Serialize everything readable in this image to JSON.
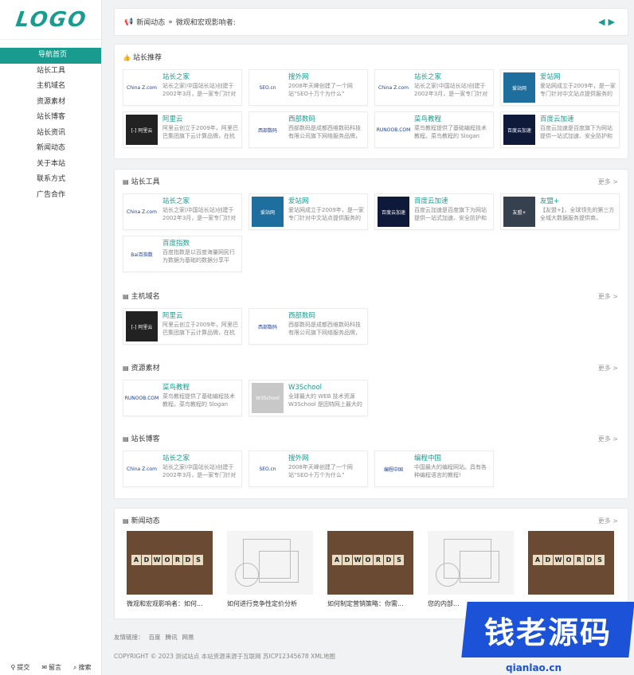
{
  "logo": "LOGO",
  "nav": [
    "导航首页",
    "站长工具",
    "主机域名",
    "资源素材",
    "站长博客",
    "站长资讯",
    "新闻动态",
    "关于本站",
    "联系方式",
    "广告合作"
  ],
  "side_footer": [
    {
      "icon": "location-icon",
      "label": "提交"
    },
    {
      "icon": "chat-icon",
      "label": "留言"
    },
    {
      "icon": "search-icon",
      "label": "搜索"
    }
  ],
  "newsbar": {
    "prefix": "新闻动态",
    "sep": "»",
    "text": "微观和宏观影响者:"
  },
  "recommend": {
    "title": "站长推荐",
    "sites": [
      {
        "name": "站长之家",
        "desc": "站长之家(中国站长站)创建于2002年3月，是一家专门针对",
        "thumb": "China Z.com",
        "style": "white"
      },
      {
        "name": "搜外网",
        "desc": "2008年天峰创建了一个网站“SEO十万个为什么”",
        "thumb": "SEO.cn",
        "style": "white"
      },
      {
        "name": "站长之家",
        "desc": "站长之家(中国站长站)创建于2002年3月，是一家专门针对",
        "thumb": "China Z.com",
        "style": "white"
      },
      {
        "name": "爱站网",
        "desc": "爱站网成立于2009年，是一家专门针对中文站点提供服务的",
        "thumb": "爱站网",
        "style": "blue"
      },
      {
        "name": "阿里云",
        "desc": "阿里云创立于2009年，阿里巴巴集团旗下云计算品牌，在杭",
        "thumb": "[-] 阿里云",
        "style": "dark"
      },
      {
        "name": "西部数码",
        "desc": "西部数码是成都西维数码科技有限公司旗下网络服务品牌，",
        "thumb": "西部数码",
        "style": "white"
      },
      {
        "name": "菜鸟教程",
        "desc": "菜鸟教程提供了基础编程技术教程。菜鸟教程的 Slogan",
        "thumb": "RUNOOB.COM",
        "style": "white"
      },
      {
        "name": "百度云加速",
        "desc": "百度云加速是百度旗下为网站提供一站式加速、安全防护和",
        "thumb": "百度云加速",
        "style": "navy"
      }
    ]
  },
  "tools": {
    "title": "站长工具",
    "more": "更多 >",
    "sites": [
      {
        "name": "站长之家",
        "desc": "站长之家(中国站长站)创建于2002年3月，是一家专门针对",
        "thumb": "China Z.com",
        "style": "white"
      },
      {
        "name": "爱站网",
        "desc": "爱站网成立于2009年，是一家专门针对中文站点提供服务的",
        "thumb": "爱站网",
        "style": "blue"
      },
      {
        "name": "百度云加速",
        "desc": "百度云加速是百度旗下为网站提供一站式加速、安全防护和",
        "thumb": "百度云加速",
        "style": "navy"
      },
      {
        "name": "友盟+",
        "desc": "【友盟+】，全球领先的第三方全域大数据服务提供商，",
        "thumb": "友盟+",
        "style": "slate"
      },
      {
        "name": "百度指数",
        "desc": "百度指数是以百度海量网民行为数据为基础的数据分享平",
        "thumb": "Bai百指数",
        "style": "white"
      }
    ]
  },
  "hosting": {
    "title": "主机域名",
    "more": "更多 >",
    "sites": [
      {
        "name": "阿里云",
        "desc": "阿里云创立于2009年，阿里巴巴集团旗下云计算品牌，在杭",
        "thumb": "[-] 阿里云",
        "style": "dark"
      },
      {
        "name": "西部数码",
        "desc": "西部数码是成都西维数码科技有限公司旗下网络服务品牌，",
        "thumb": "西部数码",
        "style": "white"
      }
    ]
  },
  "resources": {
    "title": "资源素材",
    "more": "更多 >",
    "sites": [
      {
        "name": "菜鸟教程",
        "desc": "菜鸟教程提供了基础编程技术教程。菜鸟教程的 Slogan",
        "thumb": "RUNOOB.COM",
        "style": "white"
      },
      {
        "name": "W3School",
        "desc": "全球最大的 WEB 技术资源 W3School 是因特网上最大的",
        "thumb": "W3School",
        "style": "gray"
      }
    ]
  },
  "blog": {
    "title": "站长博客",
    "more": "更多 >",
    "sites": [
      {
        "name": "站长之家",
        "desc": "站长之家(中国站长站)创建于2002年3月，是一家专门针对",
        "thumb": "China Z.com",
        "style": "white"
      },
      {
        "name": "搜外网",
        "desc": "2008年天峰创建了一个网站“SEO十万个为什么”",
        "thumb": "SEO.cn",
        "style": "white"
      },
      {
        "name": "编程中国",
        "desc": "中国最大的编程网站。具有各种编程语言的教程!",
        "thumb": "编程中国",
        "style": "white"
      }
    ]
  },
  "news": {
    "title": "新闻动态",
    "more": "更多 >",
    "items": [
      {
        "title": "微观和宏观影响者：如何...",
        "img": "adwords"
      },
      {
        "title": "如何进行竞争性定价分析",
        "img": "sketch"
      },
      {
        "title": "如何制定营销策略：你需...",
        "img": "adwords"
      },
      {
        "title": "您的内部...",
        "img": "sketch"
      },
      {
        "title": "",
        "img": "adwords"
      }
    ]
  },
  "friend_links": {
    "label": "友情链接：",
    "items": [
      "百度",
      "腾讯",
      "网易"
    ]
  },
  "copyright": "COPYRIGHT © 2023 测试站点 本站资源来源于互联网 苏ICP12345678 XML地图",
  "watermark": {
    "text": "钱老源码",
    "url": "qianlao.cn"
  },
  "accent_color": "#1a9b8f"
}
